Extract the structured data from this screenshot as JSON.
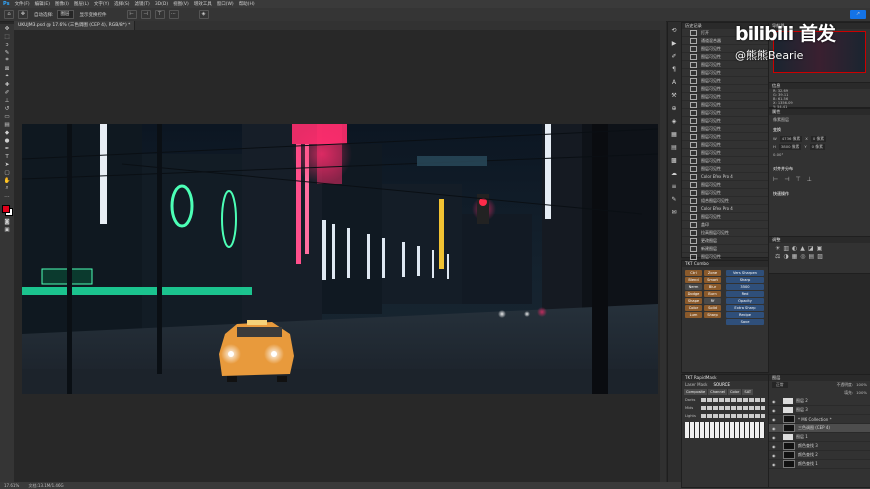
{
  "menubar": {
    "items": [
      "文件(F)",
      "编辑(E)",
      "图像(I)",
      "图层(L)",
      "文字(Y)",
      "选择(S)",
      "滤镜(T)",
      "3D(D)",
      "视图(V)",
      "增效工具",
      "窗口(W)",
      "帮助(H)"
    ]
  },
  "options": {
    "home_icon": "home-icon",
    "move_icon": "move-icon",
    "auto_select_label": "自动选择:",
    "auto_select_value": "图层",
    "transform_label": "显示变换控件"
  },
  "document": {
    "tab_title": "UKUJM3.psd @ 17.6% (三色调图 (CEP 4), RGB/8*) *"
  },
  "status": {
    "zoom": "17.61%",
    "doc_info": "文档:13.1M/1.46G"
  },
  "history": {
    "title": "历史记录",
    "items": [
      {
        "label": "打开",
        "selected": false
      },
      {
        "label": "通道混合器",
        "selected": false
      },
      {
        "label": "图层可见性",
        "selected": false
      },
      {
        "label": "图层可见性",
        "selected": false
      },
      {
        "label": "图层可见性",
        "selected": false
      },
      {
        "label": "图层可见性",
        "selected": false
      },
      {
        "label": "图层可见性",
        "selected": false
      },
      {
        "label": "图层可见性",
        "selected": false
      },
      {
        "label": "图层可见性",
        "selected": false
      },
      {
        "label": "图层可见性",
        "selected": false
      },
      {
        "label": "图层可见性",
        "selected": false
      },
      {
        "label": "图层可见性",
        "selected": false
      },
      {
        "label": "图层可见性",
        "selected": false
      },
      {
        "label": "图层可见性",
        "selected": false
      },
      {
        "label": "图层可见性",
        "selected": false
      },
      {
        "label": "图层可见性",
        "selected": false
      },
      {
        "label": "图层可见性",
        "selected": false
      },
      {
        "label": "图层可见性",
        "selected": false
      },
      {
        "label": "Color Efex Pro 4",
        "selected": false
      },
      {
        "label": "图层可见性",
        "selected": false
      },
      {
        "label": "图层可见性",
        "selected": false
      },
      {
        "label": "组合图层可见性",
        "selected": false
      },
      {
        "label": "Color Efex Pro 4",
        "selected": false
      },
      {
        "label": "图层可见性",
        "selected": false
      },
      {
        "label": "盖印",
        "selected": false
      },
      {
        "label": "拉高图层可见性",
        "selected": false
      },
      {
        "label": "更改图层",
        "selected": false
      },
      {
        "label": "新建图层",
        "selected": false
      },
      {
        "label": "图层可见性",
        "selected": false
      },
      {
        "label": "图层可见性",
        "selected": false
      },
      {
        "label": "图层可见性",
        "selected": true
      }
    ]
  },
  "script_panel": {
    "title": "TKT Combo",
    "buttons": [
      "Ctrl",
      "Zone",
      "Blend",
      "Smart",
      "Nerm",
      "Blur",
      "Dodge",
      "Burn",
      "Shape",
      "Rf",
      "Color",
      "Solid",
      "Lum",
      "Sharp"
    ],
    "side": [
      "Vers Sharpen",
      "Sharp",
      "3500",
      "Red",
      "Opacity",
      "Extra Sharp",
      "Recipe",
      "Save"
    ]
  },
  "plugin_panel": {
    "title": "TKT RapidMask",
    "mode_label": "Laser Mask",
    "source_label": "SOURCE",
    "tabs": [
      "Composite",
      "Channel",
      "Color",
      "SAT"
    ],
    "row_labels": [
      "Darks",
      "Mids",
      "Lights"
    ]
  },
  "navigator": {
    "title": "导航器",
    "zoom": "17.61%"
  },
  "info": {
    "title": "信息",
    "lines": [
      "R: 32.69",
      "G: 39.11",
      "B: 61.56",
      "X: 1356.09",
      "Y: 54.41"
    ]
  },
  "properties": {
    "title": "属性",
    "tabs": [
      "像素图层",
      "变换",
      "对齐并分布",
      "快速操作"
    ],
    "w_label": "W",
    "w_value": "4736 像素",
    "h_label": "H",
    "h_value": "3800 像素",
    "x_label": "X",
    "x_value": "0 像素",
    "y_label": "Y",
    "y_value": "0 像素",
    "angle": "0.00°"
  },
  "adjustments": {
    "title": "调整"
  },
  "layers": {
    "title": "图层",
    "blend_mode": "正常",
    "opacity_label": "不透明度:",
    "opacity_value": "100%",
    "fill_label": "填充:",
    "fill_value": "100%",
    "items": [
      {
        "name": "图层 2",
        "selected": false,
        "dark": false
      },
      {
        "name": "图层 3",
        "selected": false,
        "dark": false
      },
      {
        "name": "* M6 Collection *",
        "selected": false,
        "dark": true
      },
      {
        "name": "三色调图 (CEP 4)",
        "selected": true,
        "dark": true
      },
      {
        "name": "图层 1",
        "selected": false,
        "dark": false
      },
      {
        "name": "颜色查找 3",
        "selected": false,
        "dark": true
      },
      {
        "name": "颜色查找 2",
        "selected": false,
        "dark": true
      },
      {
        "name": "颜色查找 1",
        "selected": false,
        "dark": true
      }
    ]
  },
  "watermark": {
    "brand": "bilibili 首发",
    "user": "@熊熊Bearie"
  },
  "colors": {
    "foreground": "#e0001a",
    "background": "#ffffff",
    "accent_button": "#8b5a2b",
    "ui_panel": "#323232"
  }
}
